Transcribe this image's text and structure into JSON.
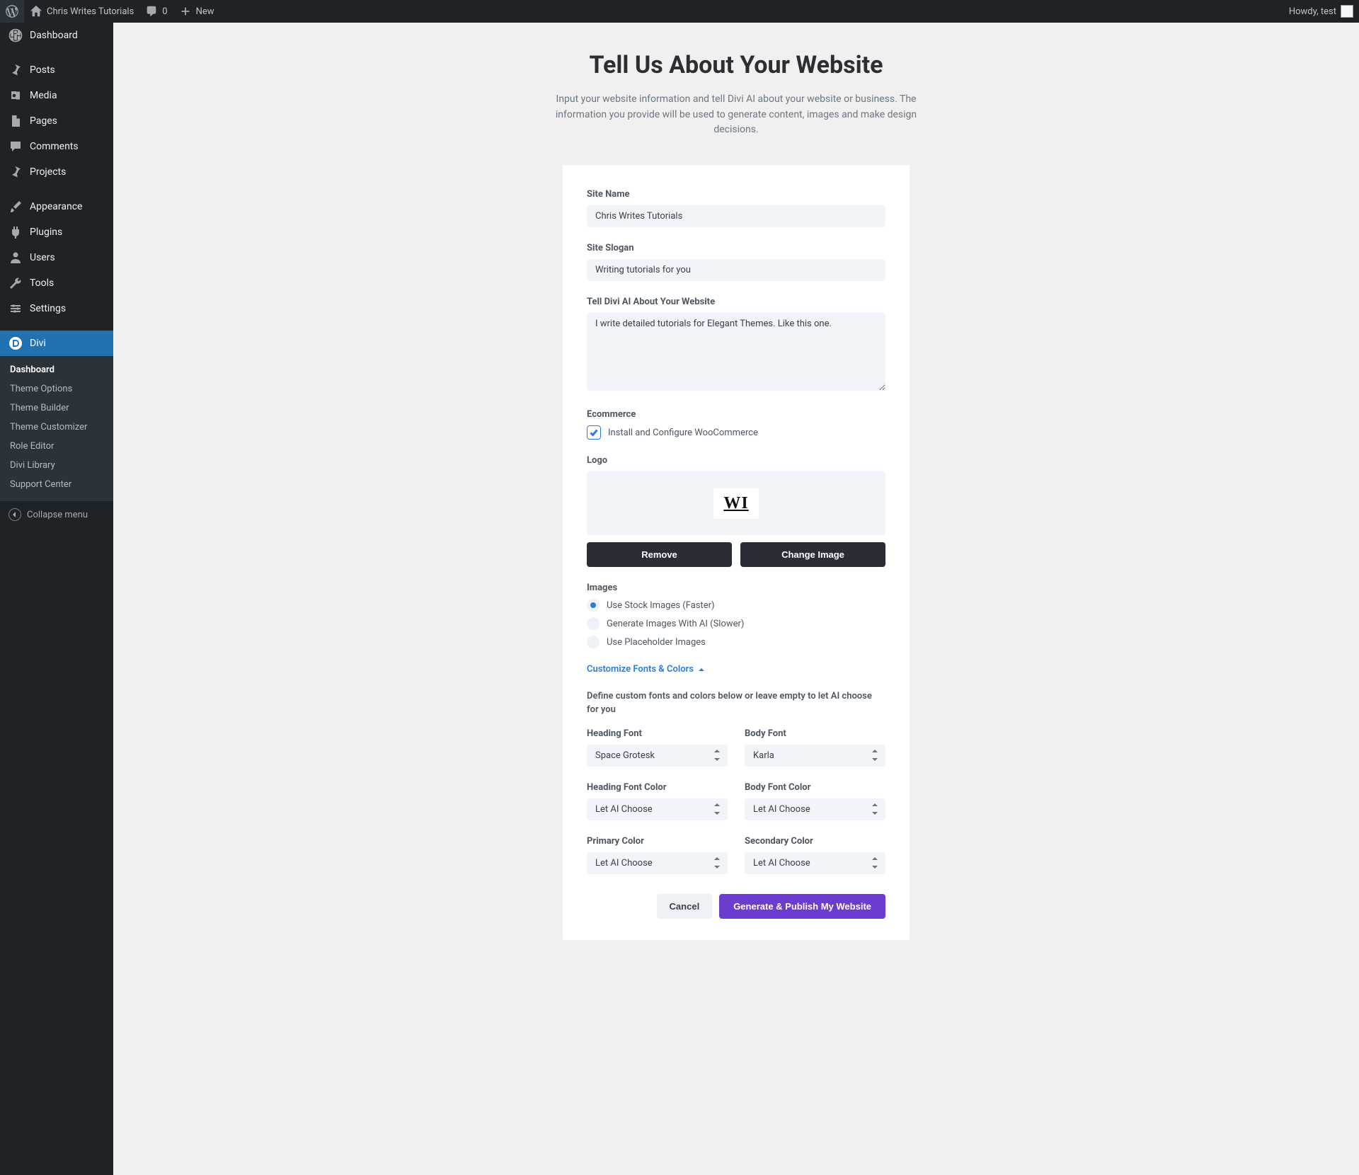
{
  "adminbar": {
    "site_title": "Chris Writes Tutorials",
    "comments_count": "0",
    "new_label": "New",
    "howdy": "Howdy, test"
  },
  "sidebar": {
    "items": [
      {
        "label": "Dashboard",
        "icon": "dashboard-icon"
      },
      {
        "label": "Posts",
        "icon": "pin-icon"
      },
      {
        "label": "Media",
        "icon": "media-icon"
      },
      {
        "label": "Pages",
        "icon": "pages-icon"
      },
      {
        "label": "Comments",
        "icon": "comment-icon"
      },
      {
        "label": "Projects",
        "icon": "pin-icon"
      },
      {
        "label": "Appearance",
        "icon": "brush-icon"
      },
      {
        "label": "Plugins",
        "icon": "plug-icon"
      },
      {
        "label": "Users",
        "icon": "user-icon"
      },
      {
        "label": "Tools",
        "icon": "wrench-icon"
      },
      {
        "label": "Settings",
        "icon": "sliders-icon"
      },
      {
        "label": "Divi",
        "icon": "divi-icon"
      }
    ],
    "submenu": [
      "Dashboard",
      "Theme Options",
      "Theme Builder",
      "Theme Customizer",
      "Role Editor",
      "Divi Library",
      "Support Center"
    ],
    "collapse": "Collapse menu"
  },
  "page": {
    "title": "Tell Us About Your Website",
    "subtitle": "Input your website information and tell Divi AI about your website or business. The information you provide will be used to generate content, images and make design decisions."
  },
  "form": {
    "site_name_label": "Site Name",
    "site_name_value": "Chris Writes Tutorials",
    "site_slogan_label": "Site Slogan",
    "site_slogan_value": "Writing tutorials for you",
    "about_label": "Tell Divi AI About Your Website",
    "about_value": "I write detailed tutorials for Elegant Themes. Like this one.",
    "ecom_label": "Ecommerce",
    "ecom_checkbox_label": "Install and Configure WooCommerce",
    "ecom_checked": true,
    "logo_label": "Logo",
    "logo_text": "WI",
    "remove_btn": "Remove",
    "change_btn": "Change Image",
    "images_label": "Images",
    "image_opts": [
      "Use Stock Images (Faster)",
      "Generate Images With AI (Slower)",
      "Use Placeholder Images"
    ],
    "image_opt_selected": 0,
    "customize_toggle": "Customize Fonts & Colors",
    "customize_help": "Define custom fonts and colors below or leave empty to let AI choose for you",
    "heading_font_label": "Heading Font",
    "heading_font_value": "Space Grotesk",
    "body_font_label": "Body Font",
    "body_font_value": "Karla",
    "heading_color_label": "Heading Font Color",
    "heading_color_value": "Let AI Choose",
    "body_color_label": "Body Font Color",
    "body_color_value": "Let AI Choose",
    "primary_color_label": "Primary Color",
    "primary_color_value": "Let AI Choose",
    "secondary_color_label": "Secondary Color",
    "secondary_color_value": "Let AI Choose",
    "cancel_btn": "Cancel",
    "submit_btn": "Generate & Publish My Website"
  },
  "colors": {
    "accent": "#6b3ccf",
    "link": "#2e7bd6",
    "sidebar_active": "#2271b1"
  }
}
